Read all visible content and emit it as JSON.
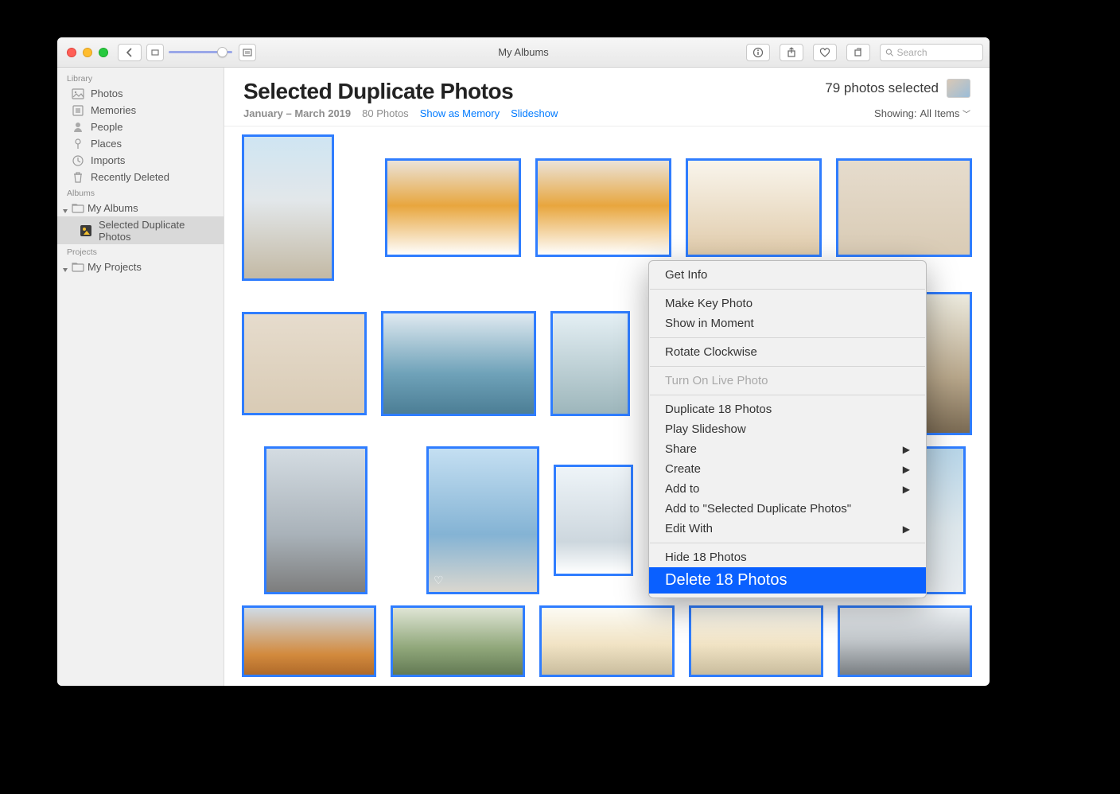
{
  "window": {
    "title": "My Albums"
  },
  "toolbar": {
    "search_placeholder": "Search"
  },
  "sidebar": {
    "sections": {
      "library": {
        "header": "Library",
        "items": [
          {
            "label": "Photos"
          },
          {
            "label": "Memories"
          },
          {
            "label": "People"
          },
          {
            "label": "Places"
          },
          {
            "label": "Imports"
          },
          {
            "label": "Recently Deleted"
          }
        ]
      },
      "albums": {
        "header": "Albums",
        "parent": "My Albums",
        "child": "Selected Duplicate Photos"
      },
      "projects": {
        "header": "Projects",
        "parent": "My Projects"
      }
    }
  },
  "main": {
    "title": "Selected Duplicate Photos",
    "selected_label": "79 photos selected",
    "date_range": "January – March 2019",
    "count_label": "80 Photos",
    "link_memory": "Show as Memory",
    "link_slideshow": "Slideshow",
    "showing_label": "Showing:",
    "showing_value": "All Items"
  },
  "context_menu": {
    "get_info": "Get Info",
    "make_key": "Make Key Photo",
    "show_moment": "Show in Moment",
    "rotate": "Rotate Clockwise",
    "live": "Turn On Live Photo",
    "duplicate": "Duplicate 18 Photos",
    "play_slideshow": "Play Slideshow",
    "share": "Share",
    "create": "Create",
    "add_to": "Add to",
    "add_to_album": "Add to \"Selected Duplicate Photos\"",
    "edit_with": "Edit With",
    "hide": "Hide 18 Photos",
    "delete": "Delete 18 Photos"
  }
}
